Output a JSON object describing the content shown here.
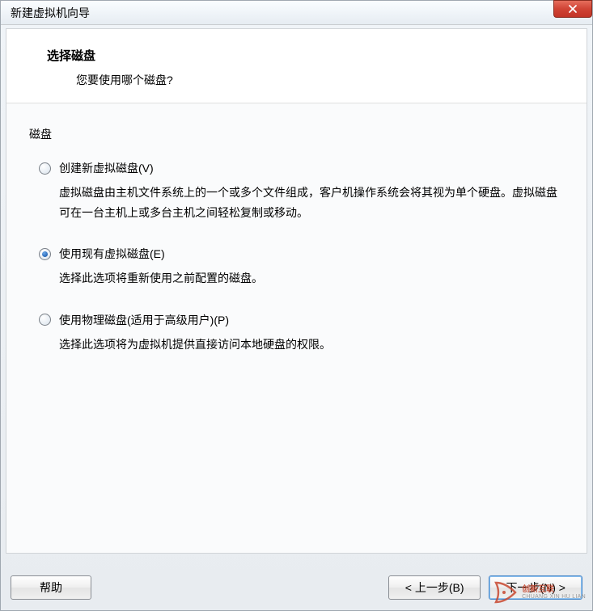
{
  "titlebar": {
    "title": "新建虚拟机向导"
  },
  "header": {
    "title": "选择磁盘",
    "subtitle": "您要使用哪个磁盘?"
  },
  "group_label": "磁盘",
  "options": [
    {
      "label": "创建新虚拟磁盘(V)",
      "desc": "虚拟磁盘由主机文件系统上的一个或多个文件组成，客户机操作系统会将其视为单个硬盘。虚拟磁盘可在一台主机上或多台主机之间轻松复制或移动。",
      "selected": false
    },
    {
      "label": "使用现有虚拟磁盘(E)",
      "desc": "选择此选项将重新使用之前配置的磁盘。",
      "selected": true
    },
    {
      "label": "使用物理磁盘(适用于高级用户)(P)",
      "desc": "选择此选项将为虚拟机提供直接访问本地硬盘的权限。",
      "selected": false
    }
  ],
  "buttons": {
    "help": "帮助",
    "back": "< 上一步(B)",
    "next": "下一步(N) >"
  },
  "watermark": {
    "main": "创新互联",
    "sub": "CHUANG XIN HU LIAN"
  }
}
